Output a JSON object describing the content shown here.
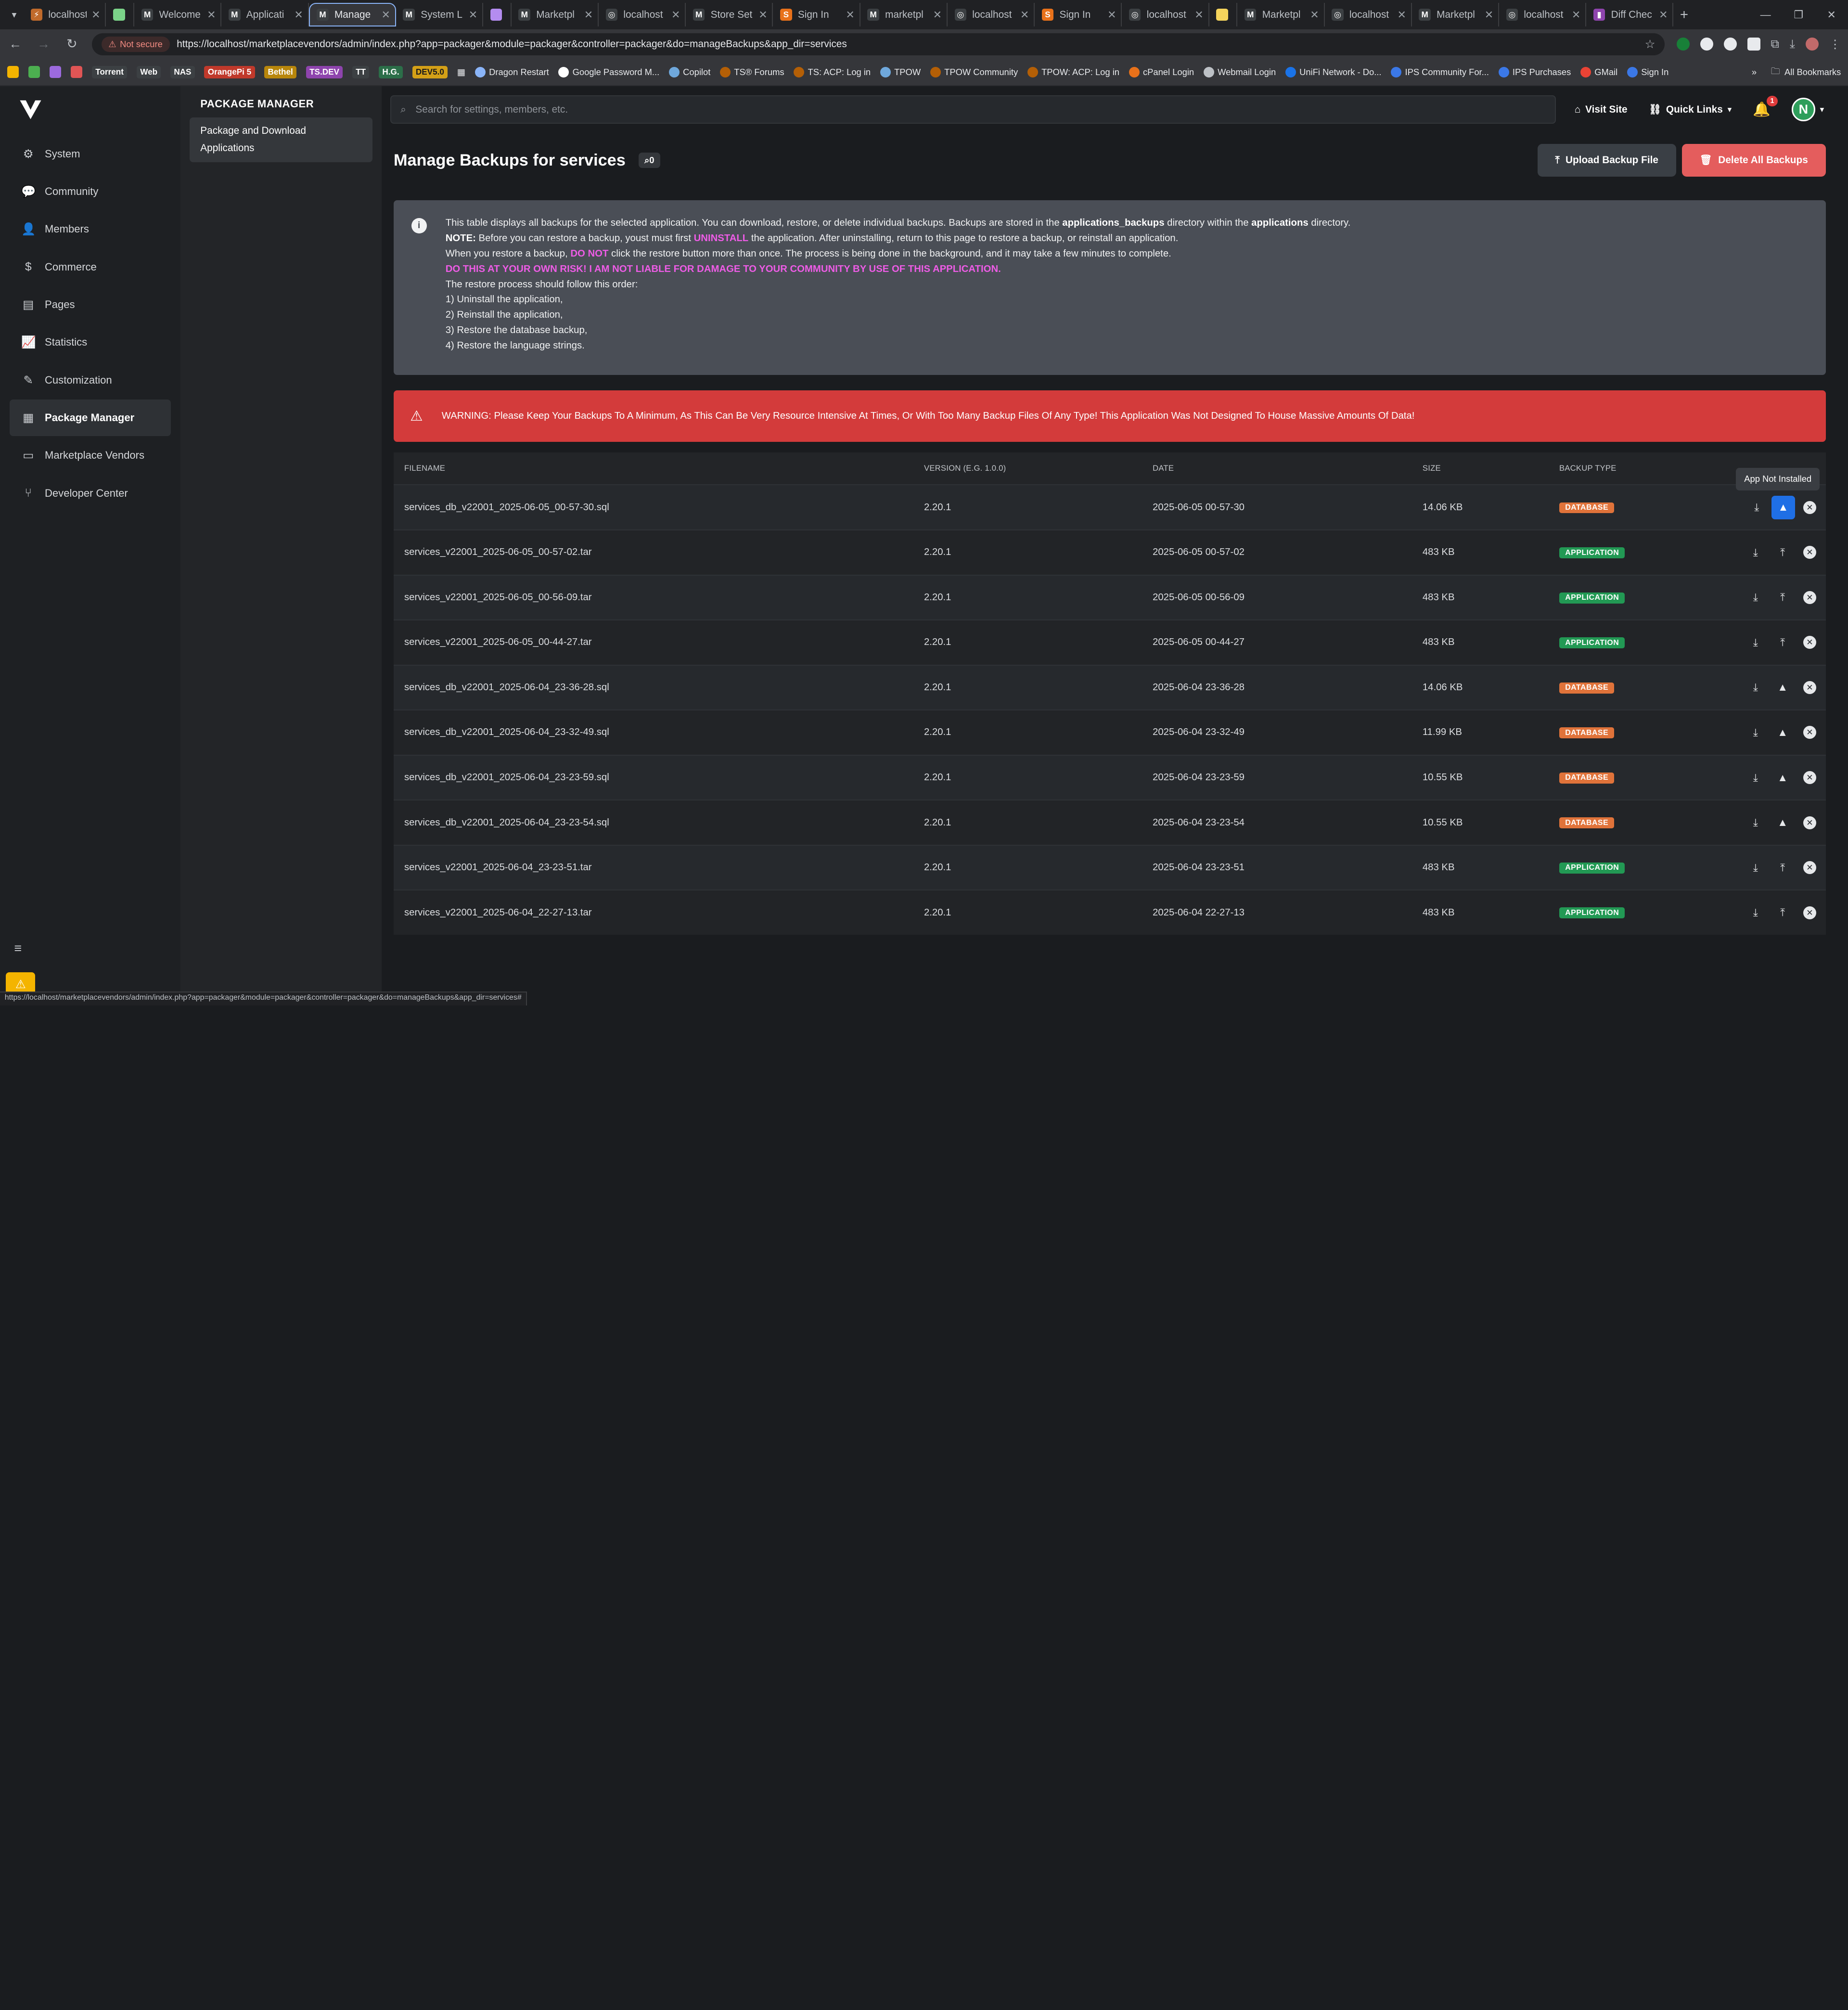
{
  "browser": {
    "tabs": [
      {
        "title": "localhost",
        "fav_color": "#c06a2b",
        "fav": "⚡"
      },
      {
        "title": "",
        "fav_color": "#7bd389",
        "fav": ""
      },
      {
        "title": "Welcome",
        "fav_color": "#3c4043",
        "fav": "M"
      },
      {
        "title": "Applicati",
        "fav_color": "#3c4043",
        "fav": "M"
      },
      {
        "title": "Manage",
        "fav_color": "#3c4043",
        "fav": "M",
        "active": true
      },
      {
        "title": "System L",
        "fav_color": "#3c4043",
        "fav": "M"
      },
      {
        "title": "",
        "fav_color": "#b48cf0",
        "fav": ""
      },
      {
        "title": "Marketpl",
        "fav_color": "#3c4043",
        "fav": "M"
      },
      {
        "title": "localhost",
        "fav_color": "#3c4043",
        "fav": "◎"
      },
      {
        "title": "Store Set",
        "fav_color": "#3c4043",
        "fav": "M"
      },
      {
        "title": "Sign In",
        "fav_color": "#e8711a",
        "fav": "S"
      },
      {
        "title": "marketpl",
        "fav_color": "#3c4043",
        "fav": "M"
      },
      {
        "title": "localhost",
        "fav_color": "#3c4043",
        "fav": "◎"
      },
      {
        "title": "Sign In",
        "fav_color": "#e8711a",
        "fav": "S"
      },
      {
        "title": "localhost",
        "fav_color": "#3c4043",
        "fav": "◎"
      },
      {
        "title": "",
        "fav_color": "#f5d45c",
        "fav": ""
      },
      {
        "title": "Marketpl",
        "fav_color": "#3c4043",
        "fav": "M"
      },
      {
        "title": "localhost",
        "fav_color": "#3c4043",
        "fav": "◎"
      },
      {
        "title": "Marketpl",
        "fav_color": "#3c4043",
        "fav": "M"
      },
      {
        "title": "localhost",
        "fav_color": "#3c4043",
        "fav": "◎"
      },
      {
        "title": "Diff Chec",
        "fav_color": "#8e44ad",
        "fav": "▮"
      }
    ],
    "not_secure_label": "Not secure",
    "url": "https://localhost/marketplacevendors/admin/index.php?app=packager&module=packager&controller=packager&do=manageBackups&app_dir=services",
    "bookmarks": [
      "Torrent",
      "Web",
      "NAS",
      "OrangePi 5",
      "Bethel",
      "TS.DEV",
      "TT",
      "H.G.",
      "DEV5.0",
      "Dragon Restart",
      "Google Password M...",
      "Copilot",
      "TS® Forums",
      "TS: ACP: Log in",
      "TPOW",
      "TPOW Community",
      "TPOW: ACP: Log in",
      "cPanel Login",
      "Webmail Login",
      "UniFi Network - Do...",
      "IPS Community For...",
      "IPS Purchases",
      "GMail",
      "Sign In"
    ],
    "all_bookmarks": "All Bookmarks",
    "status_url": "https://localhost/marketplacevendors/admin/index.php?app=packager&module=packager&controller=packager&do=manageBackups&app_dir=services#"
  },
  "sidebar": {
    "items": [
      {
        "label": "System",
        "icon": "⚙"
      },
      {
        "label": "Community",
        "icon": "💬"
      },
      {
        "label": "Members",
        "icon": "👤"
      },
      {
        "label": "Commerce",
        "icon": "$"
      },
      {
        "label": "Pages",
        "icon": "▤"
      },
      {
        "label": "Statistics",
        "icon": "📈"
      },
      {
        "label": "Customization",
        "icon": "✎"
      },
      {
        "label": "Package Manager",
        "icon": "▦",
        "active": true
      },
      {
        "label": "Marketplace Vendors",
        "icon": "▭"
      },
      {
        "label": "Developer Center",
        "icon": "⑂"
      }
    ]
  },
  "subnav": {
    "heading": "PACKAGE MANAGER",
    "item": "Package and Download Applications"
  },
  "topbar": {
    "search_placeholder": "Search for settings, members, etc.",
    "visit_site": "Visit Site",
    "quick_links": "Quick Links",
    "notifications": "1",
    "avatar_letter": "N"
  },
  "page": {
    "title": "Manage Backups for services",
    "count": "0",
    "upload_btn": "Upload Backup File",
    "delete_btn": "Delete All Backups"
  },
  "info": {
    "line1_a": "This table displays all backups for the selected application. You can download, restore, or delete individual backups. Backups are stored in the ",
    "line1_b": "applications_backups",
    "line1_c": " directory within the ",
    "line1_d": "applications",
    "line1_e": " directory.",
    "line2_a": "NOTE:",
    "line2_b": " Before you can restore a backup, youst must first ",
    "line2_c": "UNINSTALL",
    "line2_d": " the application. After uninstalling, return to this page to restore a backup, or reinstall an application.",
    "line3_a": "When you restore a backup, ",
    "line3_b": "DO NOT",
    "line3_c": " click the restore button more than once. The process is being done in the background, and it may take a few minutes to complete.",
    "line4": "DO THIS AT YOUR OWN RISK! I AM NOT LIABLE FOR DAMAGE TO YOUR COMMUNITY BY USE OF THIS APPLICATION.",
    "line5": "The restore process should follow this order:",
    "steps": [
      "1) Uninstall the application,",
      "2) Reinstall the application,",
      "3) Restore the database backup,",
      "4) Restore the language strings."
    ]
  },
  "warning": "WARNING: Please Keep Your Backups To A Minimum, As This Can Be Very Resource Intensive At Times, Or With Too Many Backup Files Of Any Type! This Application Was Not Designed To House Massive Amounts Of Data!",
  "table": {
    "headers": [
      "FILENAME",
      "VERSION (E.G. 1.0.0)",
      "DATE",
      "SIZE",
      "BACKUP TYPE"
    ],
    "rows": [
      {
        "file": "services_db_v22001_2025-06-05_00-57-30.sql",
        "version": "2.20.1",
        "date": "2025-06-05 00-57-30",
        "size": "14.06 KB",
        "type": "DATABASE"
      },
      {
        "file": "services_v22001_2025-06-05_00-57-02.tar",
        "version": "2.20.1",
        "date": "2025-06-05 00-57-02",
        "size": "483 KB",
        "type": "APPLICATION"
      },
      {
        "file": "services_v22001_2025-06-05_00-56-09.tar",
        "version": "2.20.1",
        "date": "2025-06-05 00-56-09",
        "size": "483 KB",
        "type": "APPLICATION"
      },
      {
        "file": "services_v22001_2025-06-05_00-44-27.tar",
        "version": "2.20.1",
        "date": "2025-06-05 00-44-27",
        "size": "483 KB",
        "type": "APPLICATION"
      },
      {
        "file": "services_db_v22001_2025-06-04_23-36-28.sql",
        "version": "2.20.1",
        "date": "2025-06-04 23-36-28",
        "size": "14.06 KB",
        "type": "DATABASE"
      },
      {
        "file": "services_db_v22001_2025-06-04_23-32-49.sql",
        "version": "2.20.1",
        "date": "2025-06-04 23-32-49",
        "size": "11.99 KB",
        "type": "DATABASE"
      },
      {
        "file": "services_db_v22001_2025-06-04_23-23-59.sql",
        "version": "2.20.1",
        "date": "2025-06-04 23-23-59",
        "size": "10.55 KB",
        "type": "DATABASE"
      },
      {
        "file": "services_db_v22001_2025-06-04_23-23-54.sql",
        "version": "2.20.1",
        "date": "2025-06-04 23-23-54",
        "size": "10.55 KB",
        "type": "DATABASE"
      },
      {
        "file": "services_v22001_2025-06-04_23-23-51.tar",
        "version": "2.20.1",
        "date": "2025-06-04 23-23-51",
        "size": "483 KB",
        "type": "APPLICATION"
      },
      {
        "file": "services_v22001_2025-06-04_22-27-13.tar",
        "version": "2.20.1",
        "date": "2025-06-04 22-27-13",
        "size": "483 KB",
        "type": "APPLICATION"
      }
    ],
    "tooltip": "App Not Installed"
  },
  "colors": {
    "database_pill": "#e0733a",
    "application_pill": "#229954",
    "accent_blue": "#1f6fe5",
    "danger": "#d33b3b"
  }
}
